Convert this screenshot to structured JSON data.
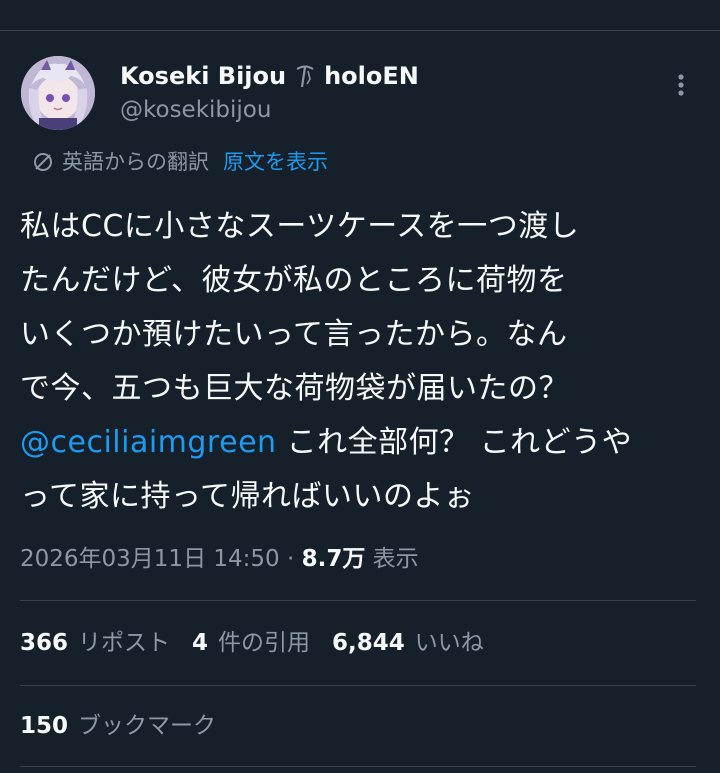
{
  "author": {
    "display_name": "Koseki Bijou",
    "display_suffix": "holoEN",
    "handle": "@kosekibijou",
    "avatar_icon": "avatar-image",
    "name_badge_icon": "pickaxe-icon"
  },
  "translation": {
    "label": "英語からの翻訳",
    "show_original": "原文を表示",
    "icon": "translate-icon"
  },
  "tweet": {
    "line1": "私はCCに小さなスーツケースを一つ渡し",
    "line2": "たんだけど、彼女が私のところに荷物を",
    "line3": "いくつか預けたいって言ったから。なん",
    "line4": "で今、五つも巨大な荷物袋が届いたの？",
    "mention": "@ceciliaimgreen",
    "line5_rest": " これ全部何？ これどうや",
    "line6": "って家に持って帰ればいいのよぉ"
  },
  "meta": {
    "timestamp": "2026年03月11日 14:50",
    "separator": " · ",
    "views_count": "8.7万",
    "views_label": " 表示"
  },
  "stats": {
    "reposts_count": "366",
    "reposts_label": "リポスト",
    "quotes_count": "4",
    "quotes_label": "件の引用",
    "likes_count": "6,844",
    "likes_label": "いいね",
    "bookmarks_count": "150",
    "bookmarks_label": "ブックマーク"
  },
  "colors": {
    "background": "#15202b",
    "text": "#f7f9f9",
    "secondary": "#8b98a5",
    "accent": "#1d9bf0",
    "divider": "#38444d"
  }
}
